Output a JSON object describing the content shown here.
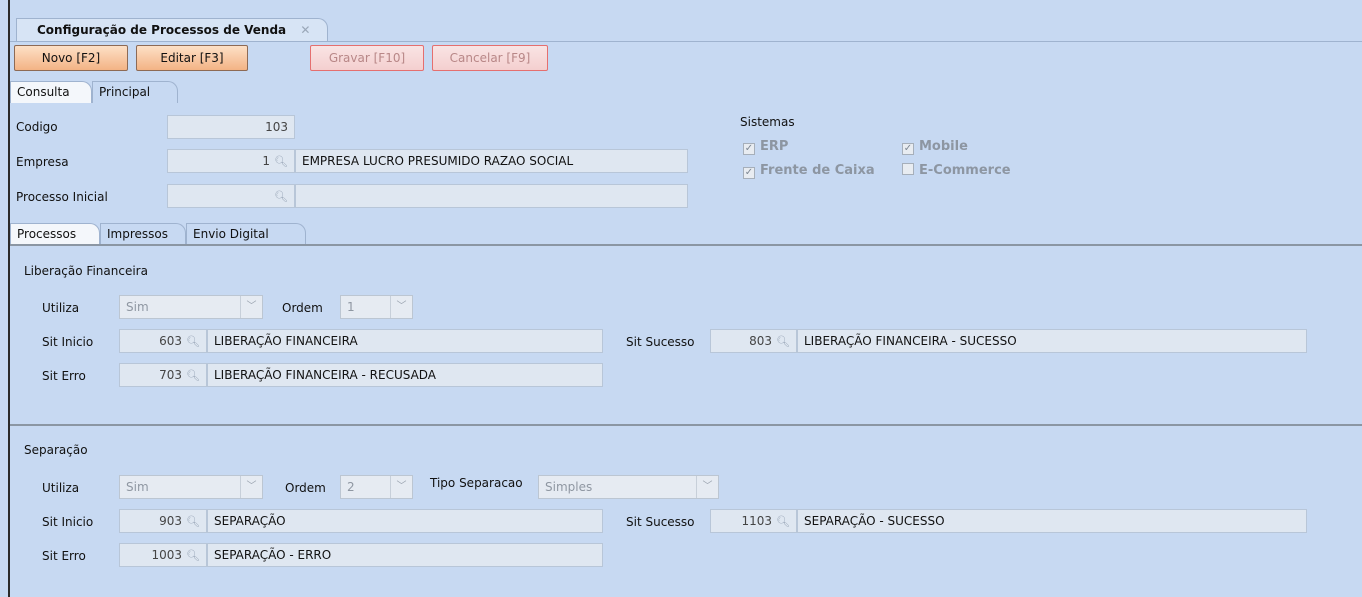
{
  "document_tab": {
    "title": "Configuração de Processos de Venda",
    "close": "✕"
  },
  "toolbar": {
    "novo": "Novo [F2]",
    "editar": "Editar [F3]",
    "gravar": "Gravar [F10]",
    "cancelar": "Cancelar [F9]"
  },
  "main_tabs": [
    "Consulta",
    "Principal"
  ],
  "form": {
    "codigo_label": "Codigo",
    "codigo_value": "103",
    "empresa_label": "Empresa",
    "empresa_code": "1",
    "empresa_name": "EMPRESA LUCRO PRESUMIDO RAZAO SOCIAL",
    "processo_label": "Processo Inicial",
    "processo_code": "",
    "processo_name": ""
  },
  "sistemas": {
    "title": "Sistemas",
    "erp": "ERP",
    "mobile": "Mobile",
    "frente": "Frente de Caixa",
    "ecommerce": "E-Commerce",
    "checked": {
      "erp": true,
      "mobile": true,
      "frente": true,
      "ecommerce": false
    }
  },
  "sub_tabs": [
    "Processos",
    "Impressos",
    "Envio Digital"
  ],
  "liberacao": {
    "title": "Liberação Financeira",
    "utiliza_label": "Utiliza",
    "utiliza_value": "Sim",
    "ordem_label": "Ordem",
    "ordem_value": "1",
    "sit_inicio_label": "Sit Inicio",
    "sit_inicio_code": "603",
    "sit_inicio_desc": "LIBERAÇÃO FINANCEIRA",
    "sit_sucesso_label": "Sit Sucesso",
    "sit_sucesso_code": "803",
    "sit_sucesso_desc": "LIBERAÇÃO FINANCEIRA - SUCESSO",
    "sit_erro_label": "Sit Erro",
    "sit_erro_code": "703",
    "sit_erro_desc": "LIBERAÇÃO FINANCEIRA - RECUSADA"
  },
  "separacao": {
    "title": "Separação",
    "utiliza_label": "Utiliza",
    "utiliza_value": "Sim",
    "ordem_label": "Ordem",
    "ordem_value": "2",
    "tipo_label": "Tipo Separacao",
    "tipo_value": "Simples",
    "sit_inicio_label": "Sit Inicio",
    "sit_inicio_code": "903",
    "sit_inicio_desc": "SEPARAÇÃO",
    "sit_sucesso_label": "Sit Sucesso",
    "sit_sucesso_code": "1103",
    "sit_sucesso_desc": "SEPARAÇÃO - SUCESSO",
    "sit_erro_label": "Sit Erro",
    "sit_erro_code": "1003",
    "sit_erro_desc": "SEPARAÇÃO - ERRO"
  },
  "icons": {
    "lookup": "search-icon",
    "dropdown": "chevron-down-icon",
    "check": "check-icon"
  }
}
